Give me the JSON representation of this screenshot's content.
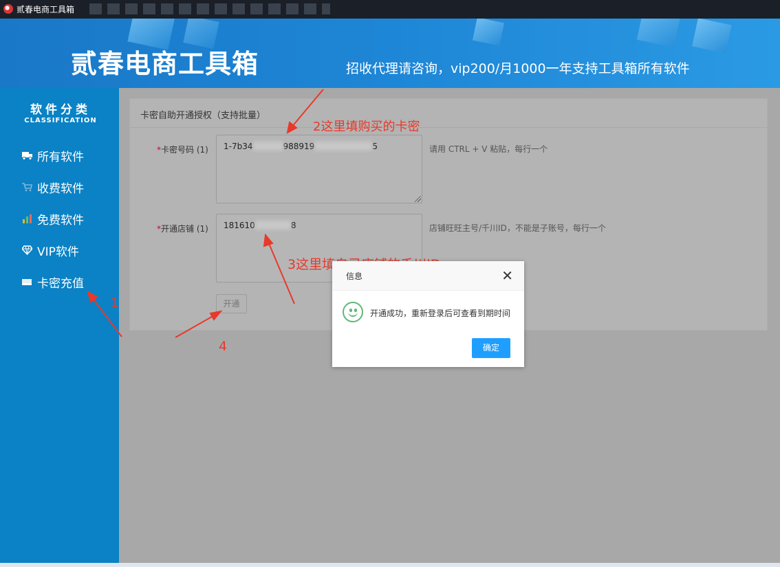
{
  "window": {
    "title": "贰春电商工具箱"
  },
  "banner": {
    "brand": "贰春电商工具箱",
    "slogan": "招收代理请咨询，vip200/月1000一年支持工具箱所有软件"
  },
  "sidebar": {
    "heading": "软件分类",
    "subheading": "CLASSIFICATION",
    "items": [
      {
        "label": "所有软件",
        "icon": "truck-icon"
      },
      {
        "label": "收费软件",
        "icon": "cart-icon"
      },
      {
        "label": "免费软件",
        "icon": "bar-chart-icon"
      },
      {
        "label": "VIP软件",
        "icon": "diamond-icon"
      },
      {
        "label": "卡密充值",
        "icon": "card-icon"
      }
    ]
  },
  "form": {
    "title": "卡密自助开通授权（支持批量）",
    "card_field": {
      "required_mark": "*",
      "label": "卡密号码 (1)",
      "value_start": "1-7b34",
      "value_mid": "988919",
      "value_end": "5",
      "hint": "请用 CTRL + V 粘贴，每行一个"
    },
    "shop_field": {
      "required_mark": "*",
      "label": "开通店铺 (1)",
      "value_start": "181610",
      "value_end": "8",
      "hint": "店铺旺旺主号/千川ID，不能是子账号，每行一个"
    },
    "submit_label": "开通"
  },
  "annotations": {
    "step1": "1",
    "step2": "2这里填购买的卡密",
    "step3": "3这里填自己店铺的千川ID",
    "step4": "4",
    "color": "#e8392b"
  },
  "dialog": {
    "title": "信息",
    "message": "开通成功，重新登录后可查看到期时间",
    "confirm_label": "确定",
    "accent": "#1e9fff"
  }
}
